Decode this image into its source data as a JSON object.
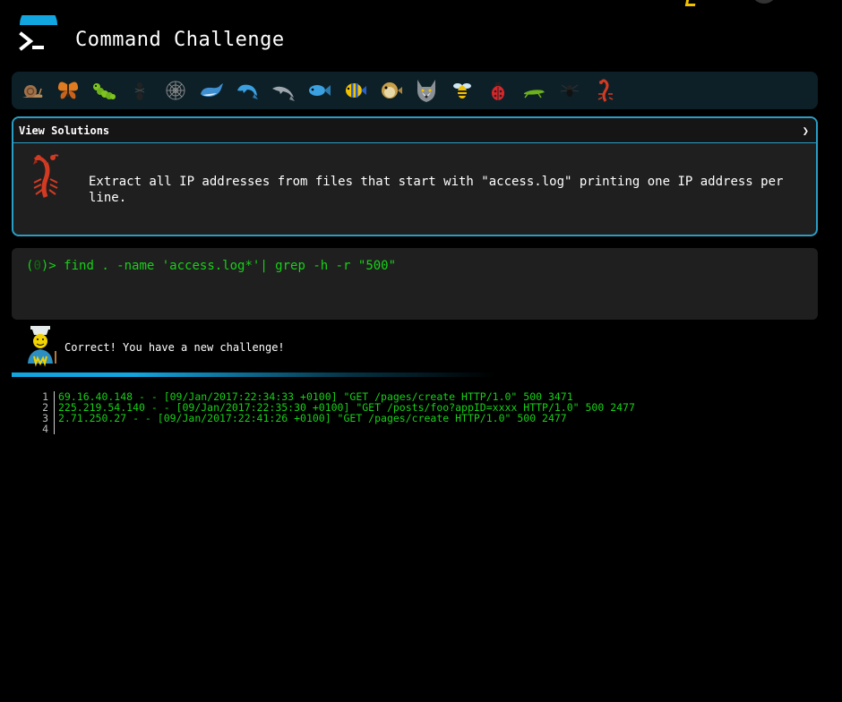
{
  "header": {
    "title": "Command Challenge"
  },
  "creatures": [
    {
      "name": "snail"
    },
    {
      "name": "butterfly"
    },
    {
      "name": "caterpillar"
    },
    {
      "name": "ant"
    },
    {
      "name": "spider-web"
    },
    {
      "name": "whale"
    },
    {
      "name": "dolphin-blue"
    },
    {
      "name": "dolphin-gray"
    },
    {
      "name": "fish"
    },
    {
      "name": "tropical-fish"
    },
    {
      "name": "blowfish"
    },
    {
      "name": "wolf"
    },
    {
      "name": "bee"
    },
    {
      "name": "ladybug"
    },
    {
      "name": "cricket"
    },
    {
      "name": "spider"
    },
    {
      "name": "scorpion"
    }
  ],
  "challenge": {
    "view_solutions_label": "View Solutions",
    "chevron": "❯",
    "description": "Extract all IP addresses from files that start with \"access.log\" printing one IP address per line."
  },
  "terminal": {
    "prompt_open": "(",
    "prompt_index": "0",
    "prompt_close": ")>",
    "command": "find . -name 'access.log*'| grep -h -r \"500\""
  },
  "feedback": {
    "message": "Correct! You have a new challenge!"
  },
  "output": {
    "lines": [
      {
        "num": "1",
        "text": "69.16.40.148 - - [09/Jan/2017:22:34:33 +0100] \"GET /pages/create HTTP/1.0\" 500 3471"
      },
      {
        "num": "2",
        "text": "225.219.54.140 - - [09/Jan/2017:22:35:30 +0100] \"GET /posts/foo?appID=xxxx HTTP/1.0\" 500 2477"
      },
      {
        "num": "3",
        "text": "2.71.250.27 - - [09/Jan/2017:22:41:26 +0100] \"GET /pages/create HTTP/1.0\" 500 2477"
      },
      {
        "num": "4",
        "text": ""
      }
    ]
  },
  "colors": {
    "accent": "#2a9dc4",
    "terminal_green": "#17d117",
    "background": "#000000"
  }
}
